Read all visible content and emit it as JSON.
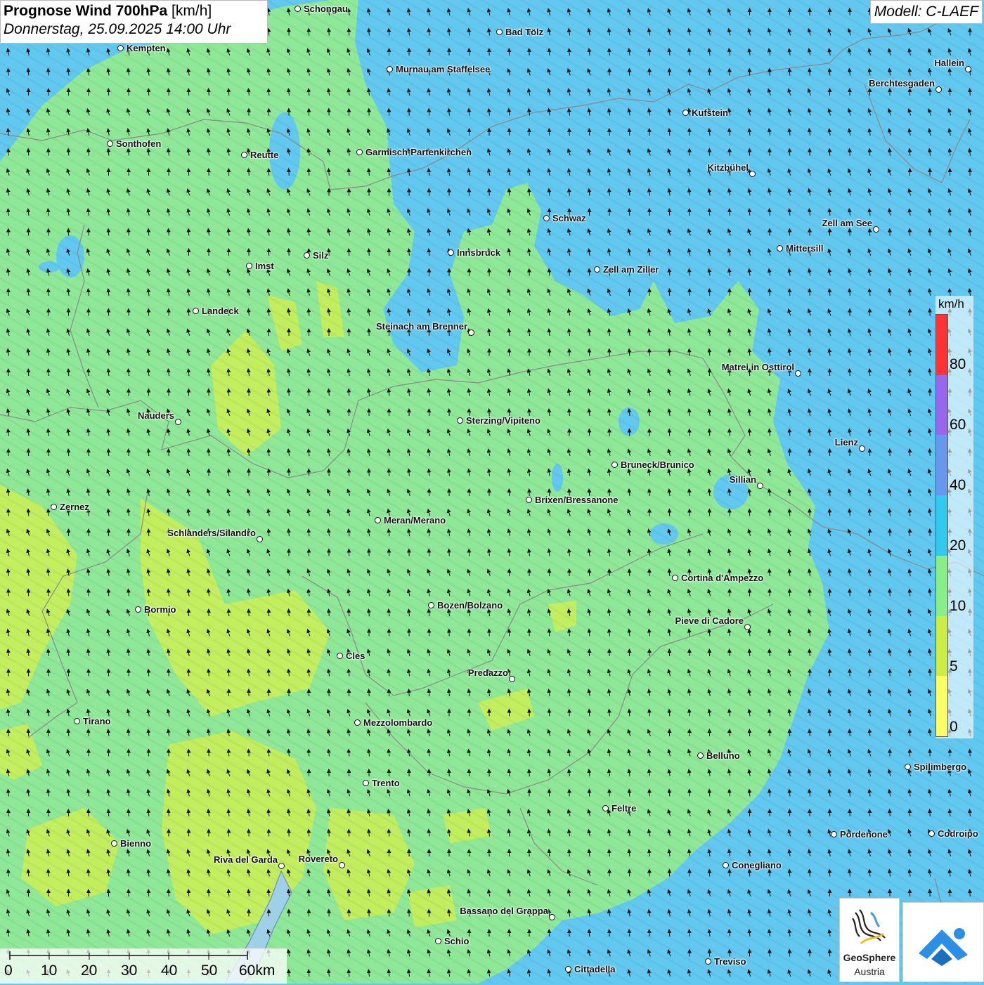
{
  "header": {
    "title_bold": "Prognose Wind 700hPa",
    "title_unit": "[km/h]",
    "datetime": "Donnerstag, 25.09.2025 14:00 Uhr",
    "model": "Modell: C-LAEF"
  },
  "legend": {
    "unit": "km/h",
    "ticks": [
      "80",
      "60",
      "40",
      "20",
      "10",
      "5",
      "0"
    ],
    "colors": [
      "#ff3333",
      "#9966ee",
      "#6699ee",
      "#33c8ee",
      "#88ee88",
      "#ccee44",
      "#ffff66"
    ]
  },
  "scale": {
    "labels": [
      "0",
      "10",
      "20",
      "30",
      "40",
      "50",
      "60km"
    ]
  },
  "logos": {
    "geosphere_line1": "GeoSphere",
    "geosphere_line2": "Austria"
  },
  "wind": {
    "prevailing_direction": "south-southwest",
    "speed_bands_kmh": [
      "0-5",
      "5-10",
      "10-20",
      "20-40"
    ]
  },
  "cities": [
    {
      "name": "Schongau",
      "label_side": "right"
    },
    {
      "name": "Bad Tölz",
      "label_side": "right"
    },
    {
      "name": "Kempten",
      "label_side": "right"
    },
    {
      "name": "Murnau am Staffelsee",
      "label_side": "right"
    },
    {
      "name": "Hallein",
      "label_side": "left"
    },
    {
      "name": "Berchtesgaden",
      "label_side": "left"
    },
    {
      "name": "Kufstein",
      "label_side": "right"
    },
    {
      "name": "Sonthofen",
      "label_side": "right"
    },
    {
      "name": "Reutte",
      "label_side": "right"
    },
    {
      "name": "Garmisch-Partenkirchen",
      "label_side": "right"
    },
    {
      "name": "Kitzbühel",
      "label_side": "left"
    },
    {
      "name": "Schwaz",
      "label_side": "right"
    },
    {
      "name": "Zell am See",
      "label_side": "left"
    },
    {
      "name": "Innsbruck",
      "label_side": "right"
    },
    {
      "name": "Silz",
      "label_side": "right"
    },
    {
      "name": "Mittersill",
      "label_side": "right"
    },
    {
      "name": "Imst",
      "label_side": "right"
    },
    {
      "name": "Zell am Ziller",
      "label_side": "right"
    },
    {
      "name": "Landeck",
      "label_side": "right"
    },
    {
      "name": "Steinach am Brenner",
      "label_side": "left"
    },
    {
      "name": "Matrei in Osttirol",
      "label_side": "left"
    },
    {
      "name": "Nauders",
      "label_side": "left"
    },
    {
      "name": "Sterzing/Vipiteno",
      "label_side": "right"
    },
    {
      "name": "Lienz",
      "label_side": "left"
    },
    {
      "name": "Bruneck/Brunico",
      "label_side": "right"
    },
    {
      "name": "Sillian",
      "label_side": "left"
    },
    {
      "name": "Brixen/Bressanone",
      "label_side": "right"
    },
    {
      "name": "Zernez",
      "label_side": "right"
    },
    {
      "name": "Meran/Merano",
      "label_side": "right"
    },
    {
      "name": "Schlanders/Silandro",
      "label_side": "left"
    },
    {
      "name": "Cortina d'Ampezzo",
      "label_side": "right"
    },
    {
      "name": "Bozen/Bolzano",
      "label_side": "right"
    },
    {
      "name": "Bormio",
      "label_side": "right"
    },
    {
      "name": "Pieve di Cadore",
      "label_side": "left"
    },
    {
      "name": "Cles",
      "label_side": "right"
    },
    {
      "name": "Predazzo",
      "label_side": "left"
    },
    {
      "name": "Tirano",
      "label_side": "right"
    },
    {
      "name": "Mezzolombardo",
      "label_side": "right"
    },
    {
      "name": "Belluno",
      "label_side": "right"
    },
    {
      "name": "Spilimbergo",
      "label_side": "right"
    },
    {
      "name": "Trento",
      "label_side": "right"
    },
    {
      "name": "Feltre",
      "label_side": "right"
    },
    {
      "name": "Pordenone",
      "label_side": "right"
    },
    {
      "name": "Codroipo",
      "label_side": "right"
    },
    {
      "name": "Bienno",
      "label_side": "right"
    },
    {
      "name": "Riva del Garda",
      "label_side": "left"
    },
    {
      "name": "Rovereto",
      "label_side": "left"
    },
    {
      "name": "Conegliano",
      "label_side": "right"
    },
    {
      "name": "Bassano del Grappa",
      "label_side": "left"
    },
    {
      "name": "Schio",
      "label_side": "right"
    },
    {
      "name": "Treviso",
      "label_side": "right"
    },
    {
      "name": "Cittadella",
      "label_side": "right"
    }
  ]
}
